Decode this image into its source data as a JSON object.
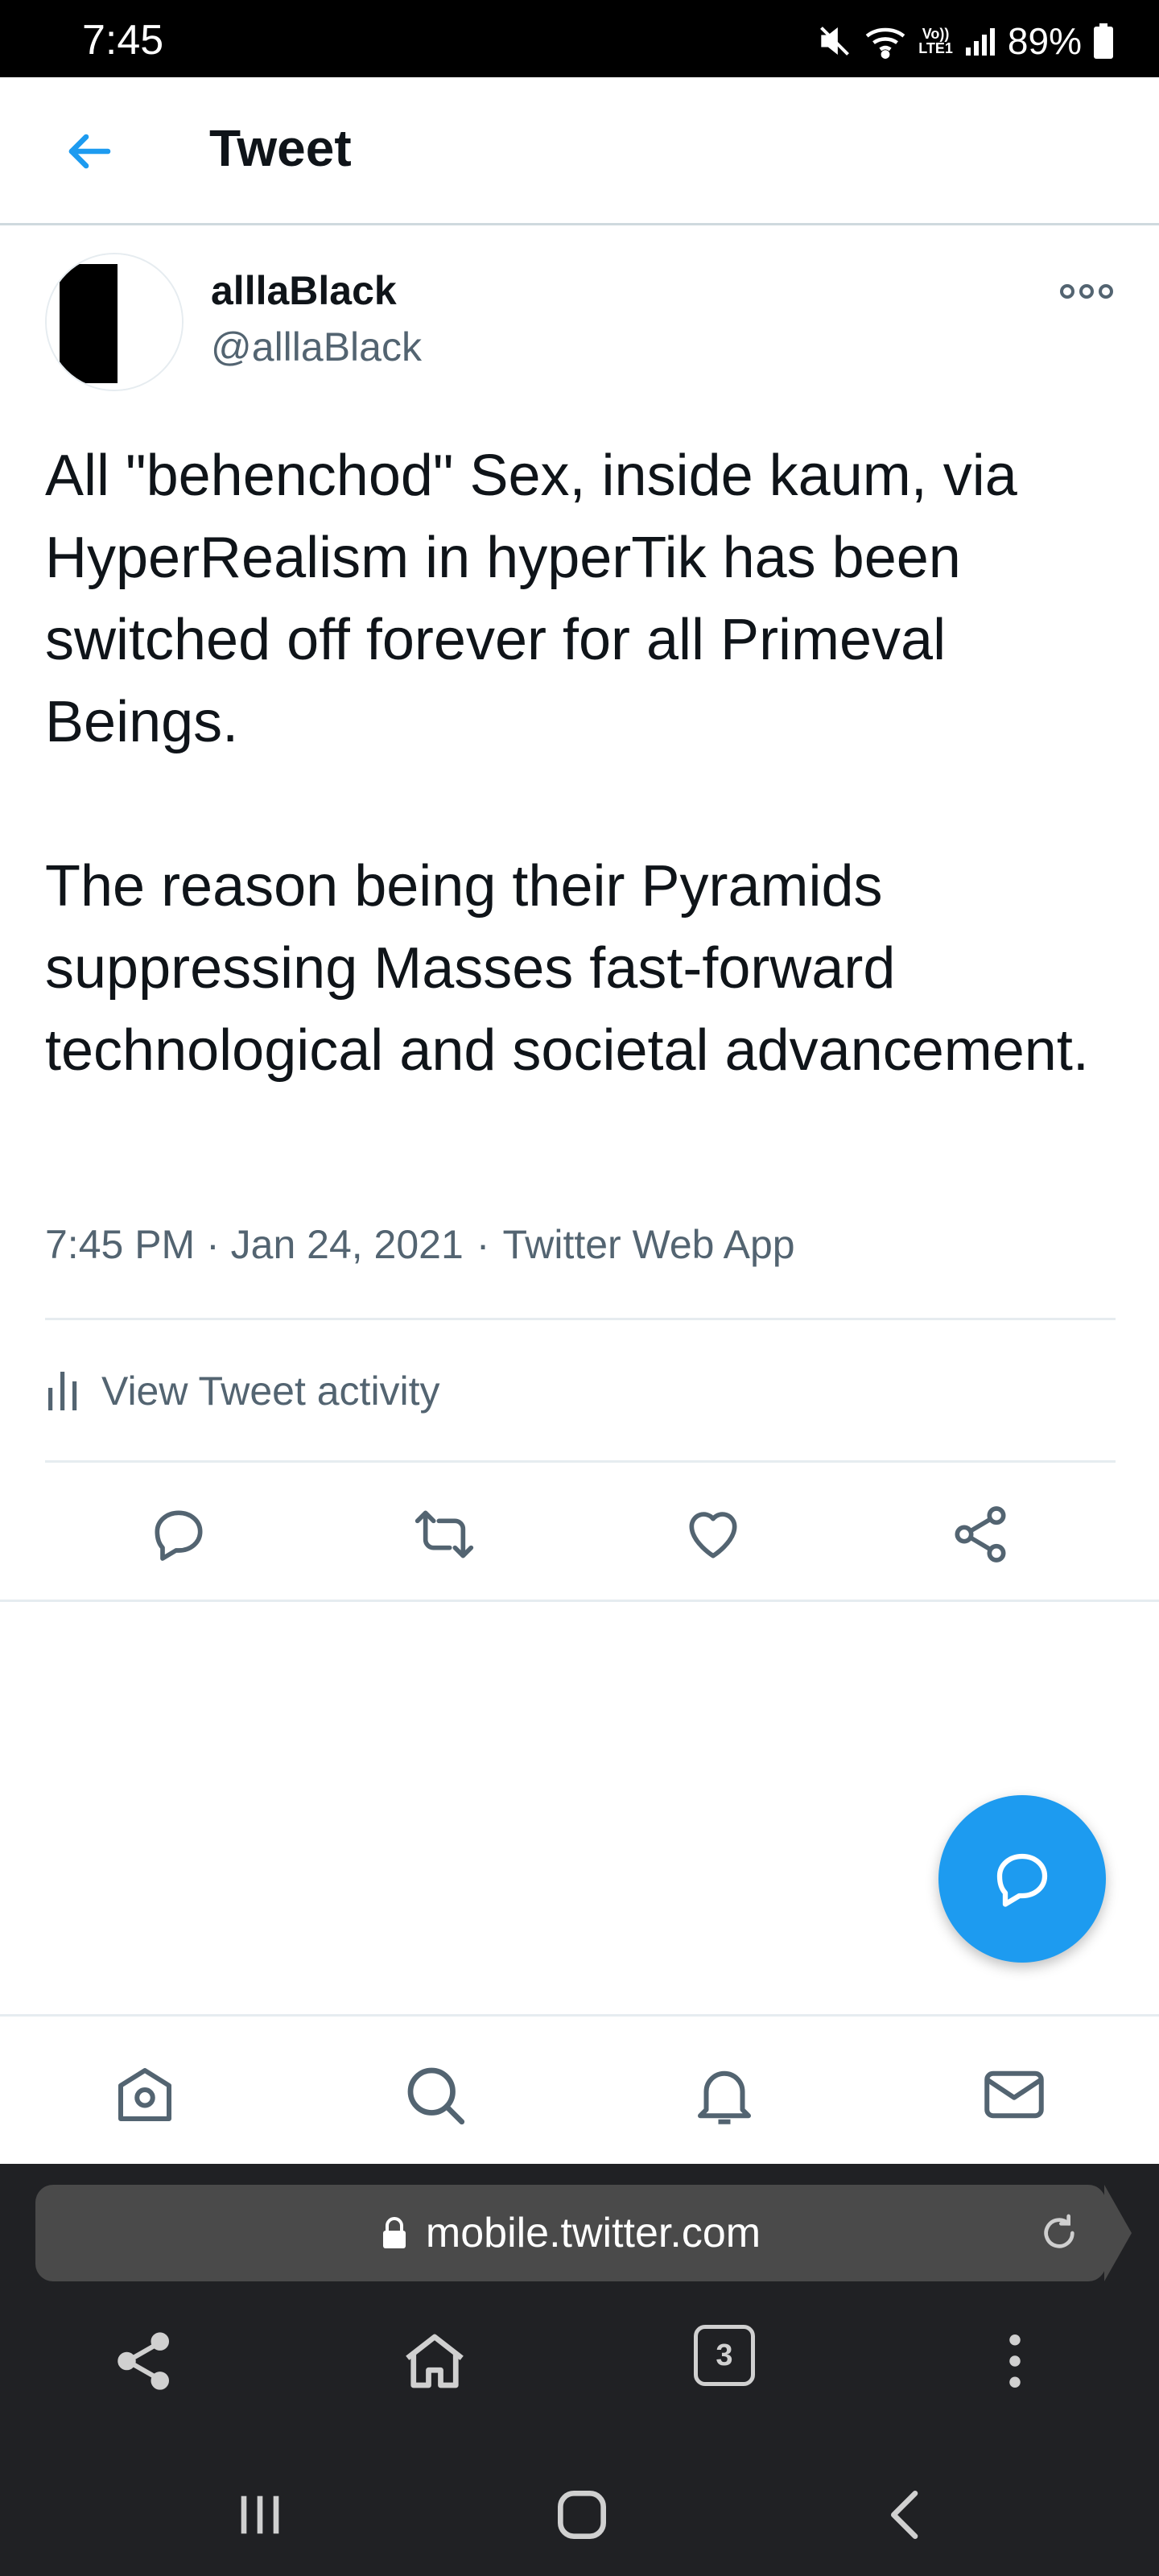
{
  "status_bar": {
    "time": "7:45",
    "network_label": "Vo))\nLTE1",
    "battery": "89%"
  },
  "header": {
    "title": "Tweet",
    "back_icon": "arrow-left-icon"
  },
  "tweet": {
    "display_name": "alllaBlack",
    "handle": "@alllaBlack",
    "text": "All \"behenchod\" Sex, inside kaum, via HyperRealism in hyperTik has been switched off forever for all Primeval Beings.\n\nThe reason being their Pyramids suppressing Masses fast-forward technological and societal advancement.",
    "timestamp": "7:45 PM · Jan 24, 2021",
    "separator": "·",
    "source": "Twitter Web App",
    "activity_label": "View Tweet activity"
  },
  "actions": [
    "reply-icon",
    "retweet-icon",
    "like-icon",
    "share-icon"
  ],
  "browser": {
    "url": "mobile.twitter.com",
    "tab_count": "3"
  },
  "colors": {
    "accent": "#1d9bf0",
    "text_primary": "#0f1419",
    "text_secondary": "#536471",
    "divider": "#e6ecf0",
    "browser_bg": "#202124"
  }
}
